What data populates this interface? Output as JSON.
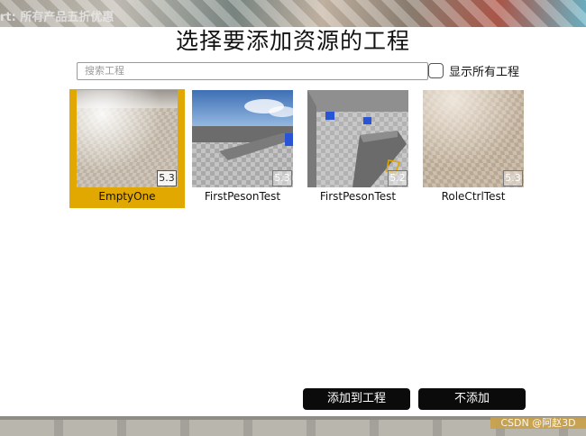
{
  "background": {
    "banner_text": "rt: 所有产品五折优惠",
    "watermark": "CSDN @阿赵3D"
  },
  "dialog": {
    "title": "选择要添加资源的工程",
    "search": {
      "placeholder": "搜索工程",
      "value": ""
    },
    "show_all": {
      "label": "显示所有工程",
      "checked": false
    },
    "projects": [
      {
        "name": "EmptyOne",
        "version": "5.3",
        "selected": true
      },
      {
        "name": "FirstPesonTest",
        "version": "5.3",
        "selected": false
      },
      {
        "name": "FirstPesonTest",
        "version": "5.2",
        "selected": false
      },
      {
        "name": "RoleCtrlTest",
        "version": "5.3",
        "selected": false
      }
    ],
    "buttons": {
      "add": "添加到工程",
      "cancel": "不添加"
    }
  },
  "colors": {
    "selected_highlight": "#e0a800",
    "button_bg": "#0b0b0b"
  }
}
